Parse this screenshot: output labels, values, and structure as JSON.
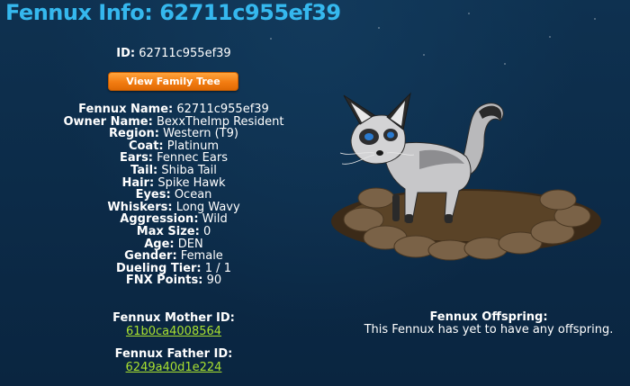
{
  "header": {
    "title": "Fennux Info: 62711c955ef39"
  },
  "id_line": {
    "label": "ID:",
    "value": "62711c955ef39"
  },
  "family_tree_button": "View Family Tree",
  "details": [
    {
      "label": "Fennux Name:",
      "value": "62711c955ef39"
    },
    {
      "label": "Owner Name:",
      "value": "BexxTheImp Resident"
    },
    {
      "label": "Region:",
      "value": "Western (T9)"
    },
    {
      "label": "Coat:",
      "value": "Platinum"
    },
    {
      "label": "Ears:",
      "value": "Fennec Ears"
    },
    {
      "label": "Tail:",
      "value": "Shiba Tail"
    },
    {
      "label": "Hair:",
      "value": "Spike Hawk"
    },
    {
      "label": "Eyes:",
      "value": "Ocean"
    },
    {
      "label": "Whiskers:",
      "value": "Long Wavy"
    },
    {
      "label": "Aggression:",
      "value": "Wild"
    },
    {
      "label": "Max Size:",
      "value": "0"
    },
    {
      "label": "Age:",
      "value": "DEN"
    },
    {
      "label": "Gender:",
      "value": "Female"
    },
    {
      "label": "Dueling Tier:",
      "value": "1 / 1"
    },
    {
      "label": "FNX Points:",
      "value": "90"
    }
  ],
  "mother": {
    "label": "Fennux Mother ID:",
    "value": "61b0ca4008564"
  },
  "father": {
    "label": "Fennux Father ID:",
    "value": "6249a40d1e224"
  },
  "offspring": {
    "label": "Fennux Offspring:",
    "text": "This Fennux has yet to have any offspring."
  },
  "colors": {
    "title": "#35b8ee",
    "link": "#a8e030",
    "button": "#f27c12",
    "background": "#0d2c47"
  }
}
